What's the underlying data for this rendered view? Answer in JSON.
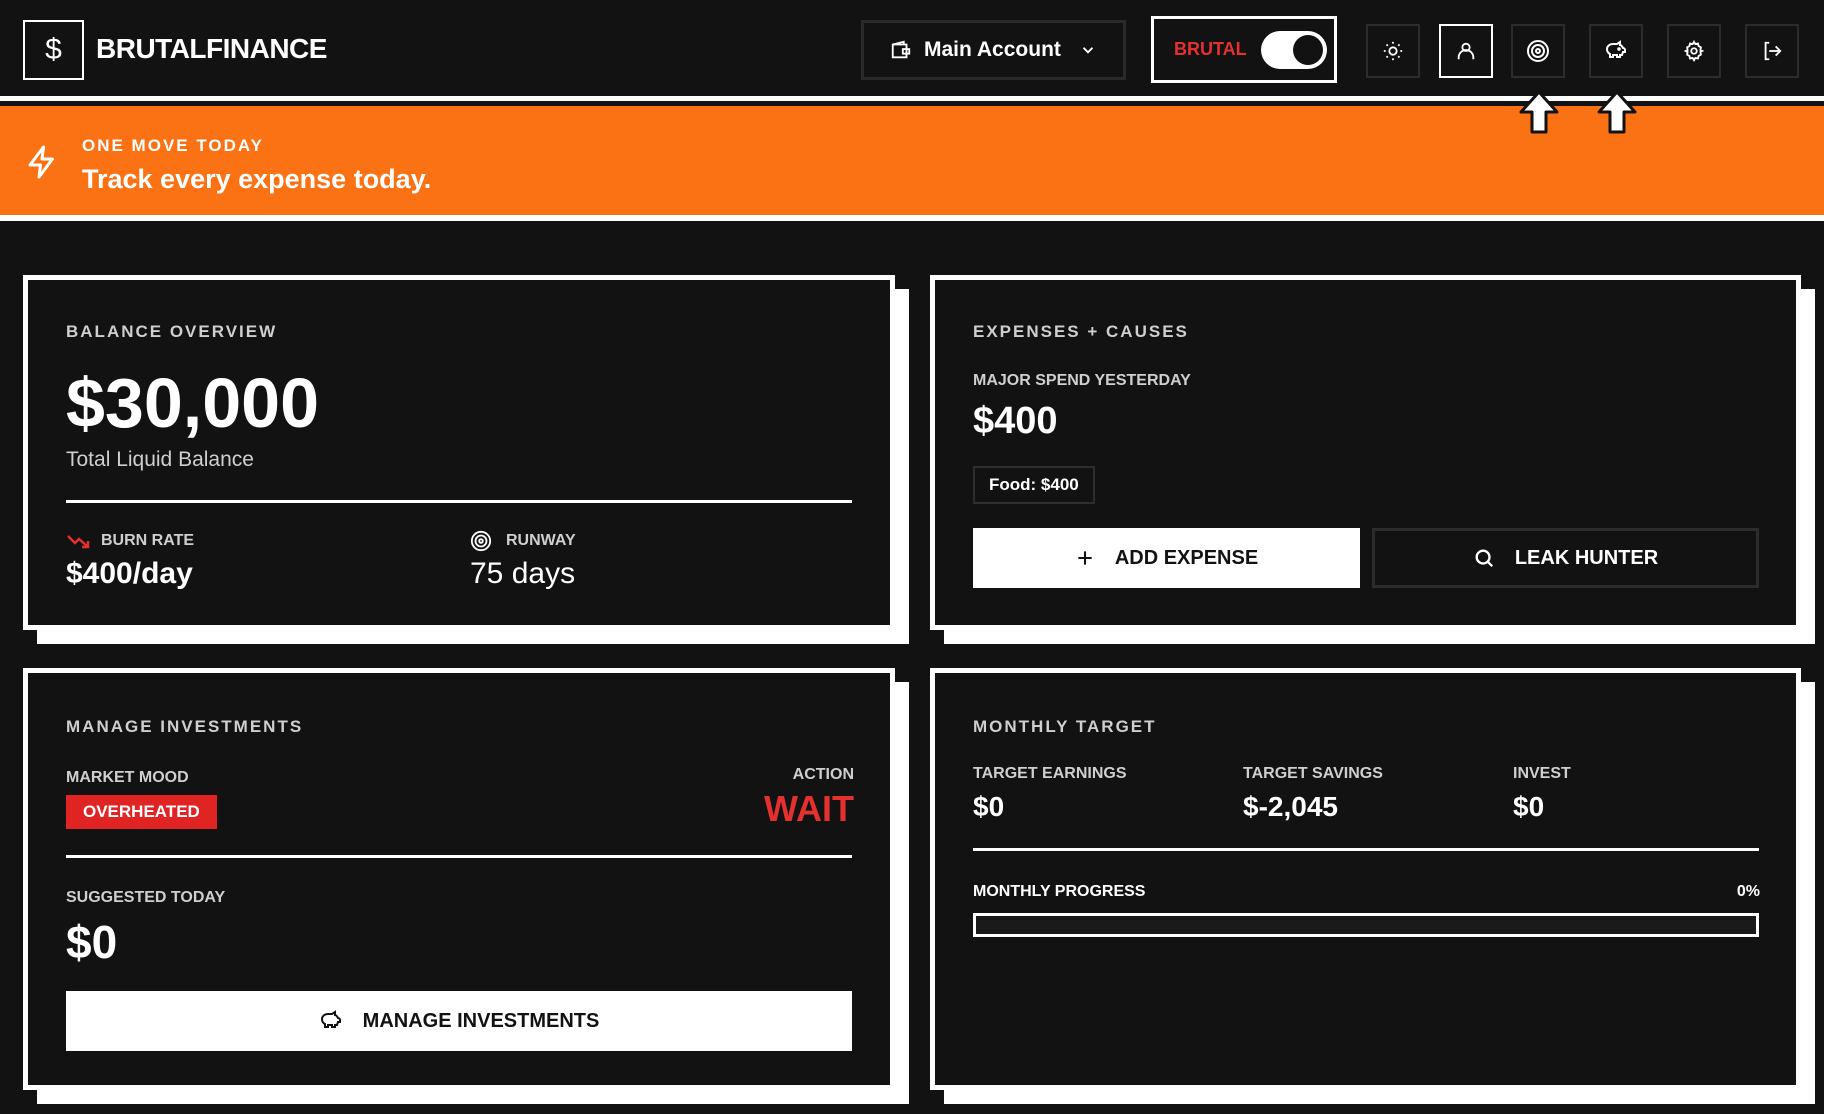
{
  "header": {
    "logo_symbol": "$",
    "app_name": "BRUTALFINANCE",
    "account_label": "Main Account",
    "mode_label": "BRUTAL",
    "mode_on": true,
    "icons": [
      "sun-icon",
      "user-icon",
      "target-icon",
      "piggy-bank-icon",
      "gear-icon",
      "logout-icon"
    ]
  },
  "banner": {
    "kicker": "ONE MOVE TODAY",
    "text": "Track every expense today."
  },
  "balance": {
    "kicker": "BALANCE OVERVIEW",
    "amount": "$30,000",
    "caption": "Total Liquid Balance",
    "burn_label": "BURN RATE",
    "burn_value": "$400/day",
    "runway_label": "RUNWAY",
    "runway_value": "75 days"
  },
  "expenses": {
    "kicker": "EXPENSES + CAUSES",
    "major_label": "MAJOR SPEND YESTERDAY",
    "major_value": "$400",
    "chip": "Food: $400",
    "add_label": "ADD EXPENSE",
    "leak_label": "LEAK HUNTER"
  },
  "investments": {
    "kicker": "MANAGE INVESTMENTS",
    "mood_label": "MARKET MOOD",
    "mood_value": "OVERHEATED",
    "action_label": "ACTION",
    "action_value": "WAIT",
    "suggested_label": "SUGGESTED TODAY",
    "suggested_value": "$0",
    "button_label": "MANAGE INVESTMENTS"
  },
  "monthly": {
    "kicker": "MONTHLY TARGET",
    "earnings_label": "TARGET EARNINGS",
    "earnings_value": "$0",
    "savings_label": "TARGET SAVINGS",
    "savings_value": "$-2,045",
    "invest_label": "INVEST",
    "invest_value": "$0",
    "progress_label": "MONTHLY PROGRESS",
    "progress_text": "0%",
    "progress_fraction": 0
  },
  "colors": {
    "accent": "#fb7215",
    "danger": "#e53030",
    "background": "#121212"
  }
}
